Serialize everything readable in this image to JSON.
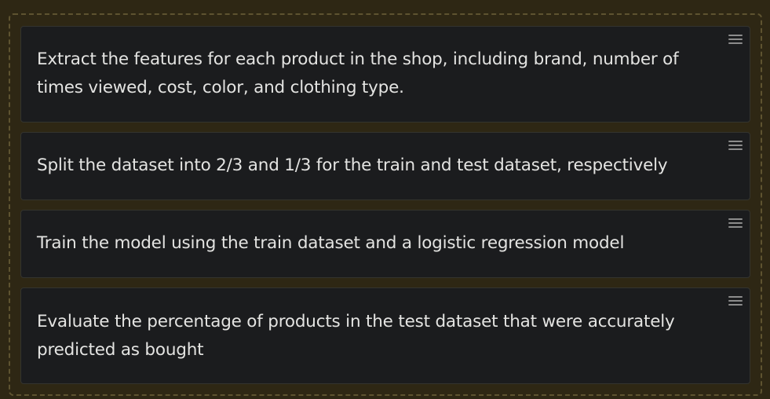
{
  "steps": [
    {
      "text": "Extract the features for each product in the shop, including brand, number of times viewed, cost, color, and clothing type.",
      "handle_icon": "drag-handle-icon"
    },
    {
      "text": "Split the dataset into 2/3 and 1/3 for the train and test dataset, respectively",
      "handle_icon": "drag-handle-icon"
    },
    {
      "text": "Train the model using the train dataset and a logistic regression model",
      "handle_icon": "drag-handle-icon"
    },
    {
      "text": "Evaluate the percentage of products in the test dataset that were accurately predicted as bought",
      "handle_icon": "drag-handle-icon"
    }
  ],
  "colors": {
    "page_background": "#2e2714",
    "card_background": "#1b1c1e",
    "text": "#e4e4e2",
    "dashed_border": "#5e5330",
    "handle": "#8c8c8c"
  }
}
